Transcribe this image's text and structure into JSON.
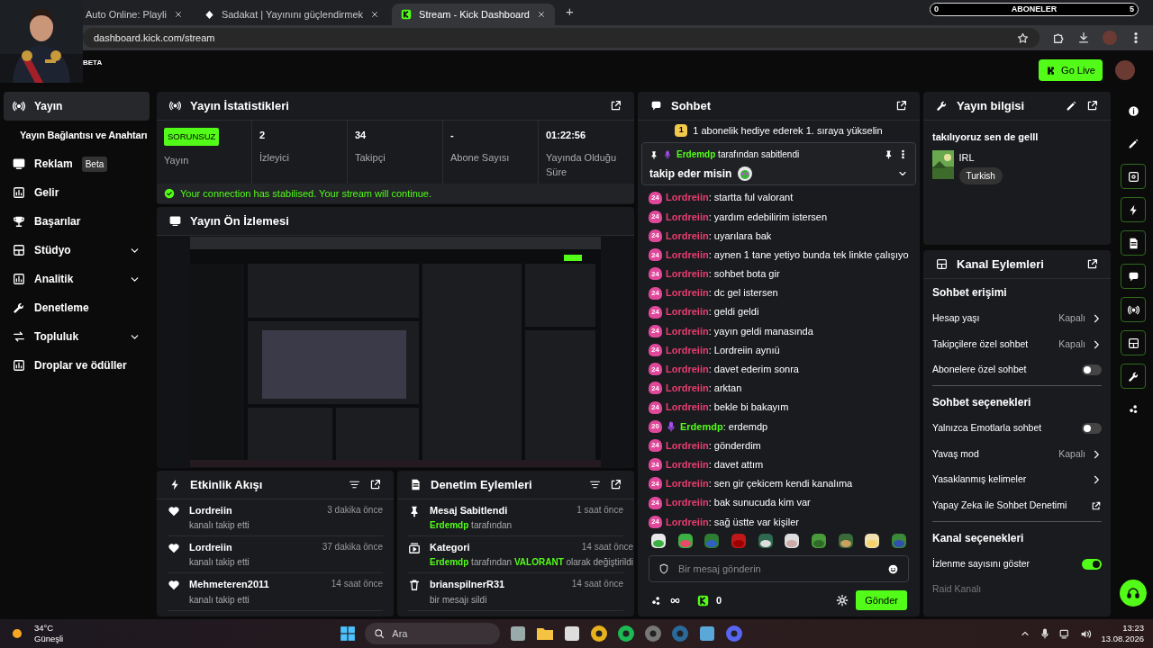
{
  "browser": {
    "tabs": [
      {
        "title": "Auto Online: Playli",
        "selected": false
      },
      {
        "title": "Sadakat | Yayınını güçlendirmek",
        "selected": false
      },
      {
        "title": "Stream - Kick Dashboard",
        "selected": true
      }
    ],
    "new_tab": "+",
    "url": "dashboard.kick.com/stream"
  },
  "sub_goal": {
    "current": "0",
    "label": "ABONELER",
    "target": "5"
  },
  "header": {
    "beta": "BETA",
    "go_live": "Go Live"
  },
  "sidebar": {
    "items": [
      {
        "label": "Yayın",
        "kind": "main",
        "selected": true,
        "expandable": false
      },
      {
        "label": "Yayın Bağlantısı ve Anahtarı",
        "kind": "sub",
        "selected": false,
        "expandable": false
      },
      {
        "label": "Reklam",
        "badge": "Beta",
        "kind": "main",
        "selected": false,
        "expandable": false
      },
      {
        "label": "Gelir",
        "kind": "main",
        "selected": false,
        "expandable": false
      },
      {
        "label": "Başarılar",
        "kind": "main",
        "selected": false,
        "expandable": false
      },
      {
        "label": "Stüdyo",
        "kind": "main",
        "selected": false,
        "expandable": true
      },
      {
        "label": "Analitik",
        "kind": "main",
        "selected": false,
        "expandable": true
      },
      {
        "label": "Denetleme",
        "kind": "main",
        "selected": false,
        "expandable": false
      },
      {
        "label": "Topluluk",
        "kind": "main",
        "selected": false,
        "expandable": true
      },
      {
        "label": "Droplar ve ödüller",
        "kind": "main",
        "selected": false,
        "expandable": false
      }
    ]
  },
  "stats": {
    "title": "Yayın İstatistikleri",
    "cells": [
      {
        "kind": "status",
        "value": "SORUNSUZ",
        "label": "Yayın"
      },
      {
        "kind": "number",
        "value": "2",
        "label": "İzleyici"
      },
      {
        "kind": "number",
        "value": "34",
        "label": "Takipçi"
      },
      {
        "kind": "number",
        "value": "-",
        "label": "Abone Sayısı"
      },
      {
        "kind": "number",
        "value": "01:22:56",
        "label": "Yayında Olduğu Süre"
      }
    ],
    "notice": "Your connection has stabilised. Your stream will continue."
  },
  "preview": {
    "title": "Yayın Ön İzlemesi",
    "kind": "picture"
  },
  "activity": {
    "title": "Etkinlik Akışı",
    "items": [
      {
        "name": "Lordreiin",
        "action": "kanalı takip etti",
        "time": "3 dakika önce"
      },
      {
        "name": "Lordreiin",
        "action": "kanalı takip etti",
        "time": "37 dakika önce"
      },
      {
        "name": "Mehmeteren2011",
        "action": "kanalı takip etti",
        "time": "14 saat önce"
      }
    ]
  },
  "moderation": {
    "title": "Denetim Eylemleri",
    "items": [
      {
        "kind": "pin",
        "title": "Mesaj Sabitlendi",
        "time": "1 saat önce",
        "detail": [
          {
            "text": "Erdemdp",
            "highlight": true
          },
          {
            "text": " tarafından",
            "highlight": false
          }
        ]
      },
      {
        "kind": "category",
        "title": "Kategori",
        "time": "14 saat önce",
        "detail": [
          {
            "text": "Erdemdp",
            "highlight": true
          },
          {
            "text": " tarafından ",
            "highlight": false
          },
          {
            "text": "VALORANT",
            "highlight": true
          },
          {
            "text": " olarak değiştirildi",
            "highlight": false
          }
        ]
      },
      {
        "kind": "delete",
        "title": "brianspilnerR31",
        "time": "14 saat önce",
        "detail": [
          {
            "text": "bir mesajı sildi",
            "highlight": false
          }
        ]
      }
    ]
  },
  "chat": {
    "title": "Sohbet",
    "gift_banner": {
      "rank": "1",
      "text": "1 abonelik hediye ederek 1. sıraya yükselin"
    },
    "pinned": {
      "by": "Erdemdp",
      "by_suffix": " tarafından sabitlendi",
      "text": "takip eder misin"
    },
    "messages": [
      {
        "kind": "viewer",
        "badge": "24",
        "user": "Lordreiin",
        "text": ": startta ful valorant"
      },
      {
        "kind": "viewer",
        "badge": "24",
        "user": "Lordreiin",
        "text": ": yardım edebilirim istersen"
      },
      {
        "kind": "viewer",
        "badge": "24",
        "user": "Lordreiin",
        "text": ": uyarılara bak"
      },
      {
        "kind": "viewer",
        "badge": "24",
        "user": "Lordreiin",
        "text": ": aynen 1 tane yetiyo bunda tek linkte çalışıyo"
      },
      {
        "kind": "viewer",
        "badge": "24",
        "user": "Lordreiin",
        "text": ": sohbet bota gir"
      },
      {
        "kind": "viewer",
        "badge": "24",
        "user": "Lordreiin",
        "text": ": dc gel istersen"
      },
      {
        "kind": "viewer",
        "badge": "24",
        "user": "Lordreiin",
        "text": ": geldi geldi"
      },
      {
        "kind": "viewer",
        "badge": "24",
        "user": "Lordreiin",
        "text": ": yayın geldi manasında"
      },
      {
        "kind": "viewer",
        "badge": "24",
        "user": "Lordreiin",
        "text": ": Lordreiin aynıü"
      },
      {
        "kind": "viewer",
        "badge": "24",
        "user": "Lordreiin",
        "text": ": davet ederim sonra"
      },
      {
        "kind": "viewer",
        "badge": "24",
        "user": "Lordreiin",
        "text": ": arktan"
      },
      {
        "kind": "viewer",
        "badge": "24",
        "user": "Lordreiin",
        "text": ": bekle bi bakayım"
      },
      {
        "kind": "broadcaster",
        "badge": "20",
        "user": "Erdemdp",
        "text": ": erdemdp"
      },
      {
        "kind": "viewer",
        "badge": "24",
        "user": "Lordreiin",
        "text": ": gönderdim"
      },
      {
        "kind": "viewer",
        "badge": "24",
        "user": "Lordreiin",
        "text": ": davet attım"
      },
      {
        "kind": "viewer",
        "badge": "24",
        "user": "Lordreiin",
        "text": ": sen gir çekicem kendi kanalıma"
      },
      {
        "kind": "viewer",
        "badge": "24",
        "user": "Lordreiin",
        "text": ": bak sunucuda kim var"
      },
      {
        "kind": "viewer",
        "badge": "24",
        "user": "Lordreiin",
        "text": ": sağ üstte var kişiler"
      }
    ],
    "input": {
      "placeholder": "Bir mesaj gönderin"
    },
    "points": "0",
    "send": "Gönder"
  },
  "stream_info": {
    "title": "Yayın bilgisi",
    "stream_title": "takılıyoruz sen de gelll",
    "category": "IRL",
    "tag": "Turkish"
  },
  "channel_actions": {
    "title": "Kanal Eylemleri",
    "sections": [
      {
        "title": "Sohbet erişimi",
        "rows": [
          {
            "kind": "nav",
            "label": "Hesap yaşı",
            "value": "Kapalı",
            "disabled": false
          },
          {
            "kind": "nav",
            "label": "Takipçilere özel sohbet",
            "value": "Kapalı",
            "disabled": false
          },
          {
            "kind": "toggle",
            "label": "Abonelere özel sohbet",
            "on": false,
            "disabled": false
          }
        ]
      },
      {
        "title": "Sohbet seçenekleri",
        "rows": [
          {
            "kind": "toggle",
            "label": "Yalnızca Emotlarla sohbet",
            "on": false,
            "disabled": false
          },
          {
            "kind": "nav",
            "label": "Yavaş mod",
            "value": "Kapalı",
            "disabled": false
          },
          {
            "kind": "nav",
            "label": "Yasaklanmış kelimeler",
            "disabled": false
          },
          {
            "kind": "external",
            "label": "Yapay Zeka ile Sohbet Denetimi",
            "disabled": false
          }
        ]
      },
      {
        "title": "Kanal seçenekleri",
        "rows": [
          {
            "kind": "toggle",
            "label": "İzlenme sayısını göster",
            "on": true,
            "disabled": false
          },
          {
            "kind": "plain",
            "label": "Raid Kanalı",
            "disabled": true
          }
        ]
      }
    ]
  },
  "taskbar": {
    "temperature": "34°C",
    "condition": "Güneşli",
    "search_placeholder": "Ara",
    "time": "13:23",
    "date": "13.08.2026"
  }
}
